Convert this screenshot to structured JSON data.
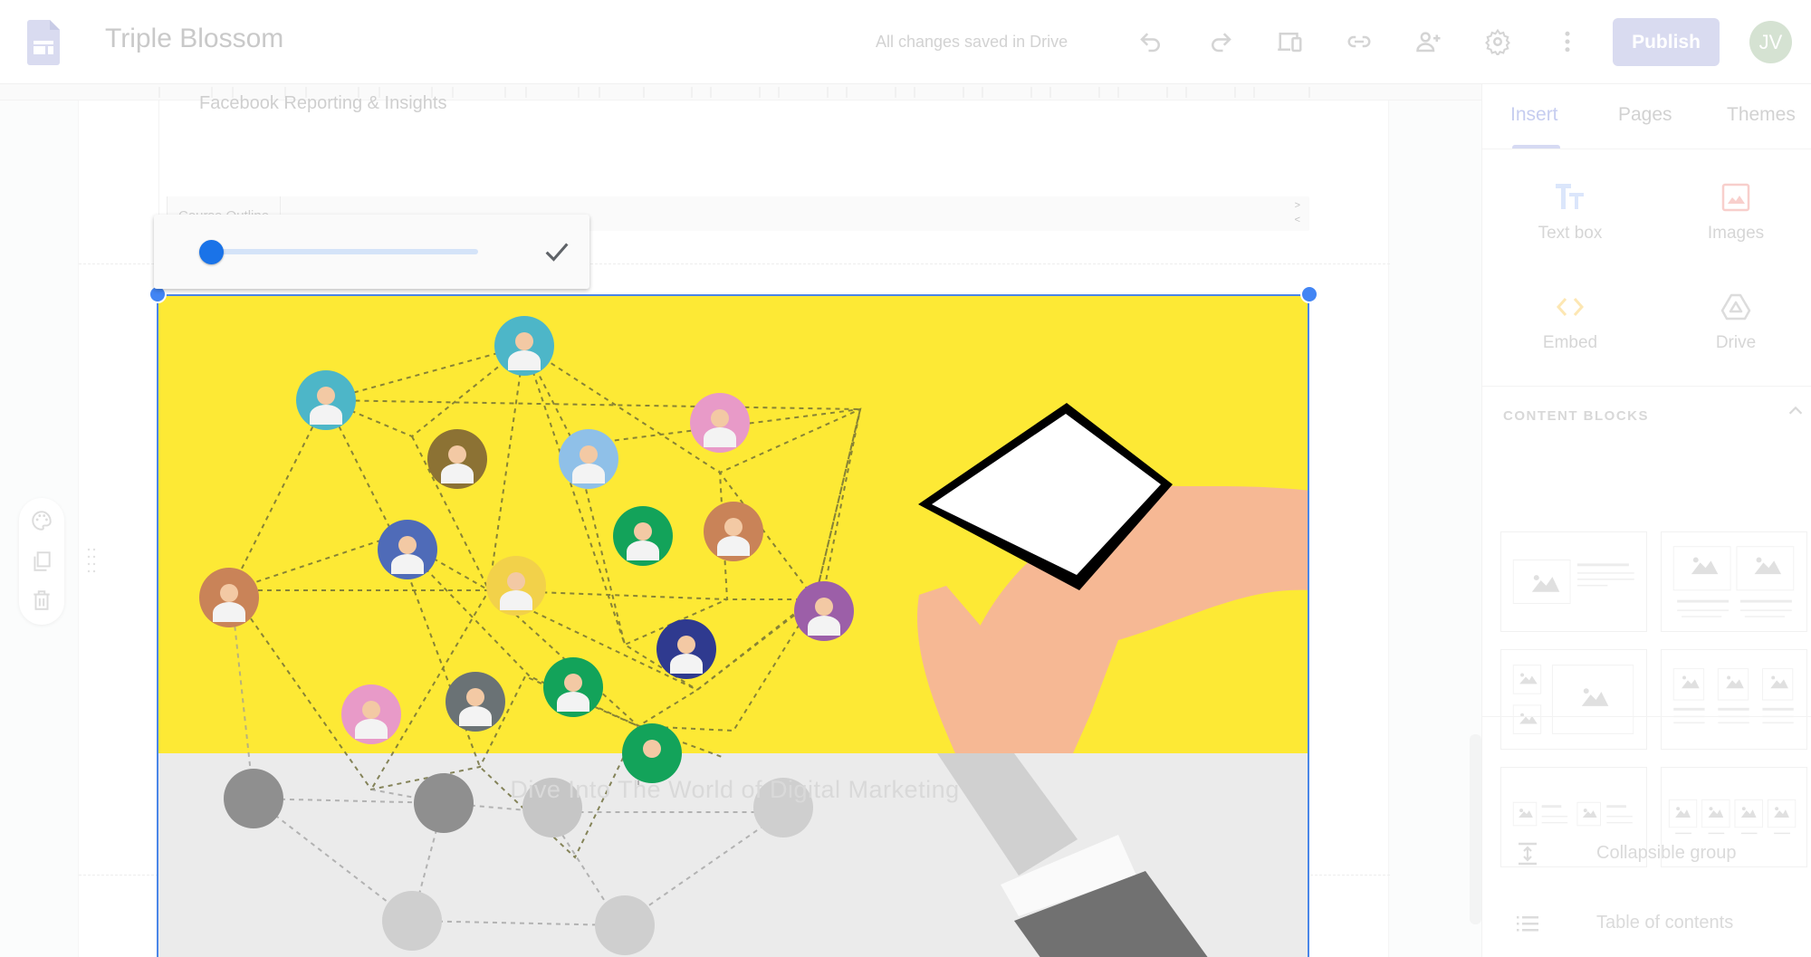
{
  "app": {
    "document_title": "Triple Blossom",
    "save_status": "All changes saved in Drive",
    "publish_label": "Publish",
    "user_initials": "JV",
    "colors": {
      "accent": "#1a73e8",
      "selection": "#4a86e8",
      "publish_bg": "#d9dbf0",
      "avatar_bg": "#d5e2d2",
      "banner_yellow": "#fde935"
    }
  },
  "toolbar": {
    "icons": [
      "undo-icon",
      "redo-icon",
      "preview-icon",
      "link-icon",
      "add-person-icon",
      "settings-icon",
      "more-vert-icon"
    ]
  },
  "canvas": {
    "section_text": "Facebook Reporting & Insights",
    "nav_tab": "Course Outline",
    "nav_arrows": {
      "next": ">",
      "prev": "<"
    },
    "banner_overlay_text": "Dive Into The World of Digital Marketing",
    "image_slider": {
      "value_fraction": 0.0
    },
    "floating_tools": [
      "palette-icon",
      "duplicate-icon",
      "delete-icon"
    ]
  },
  "sidebar": {
    "tabs": [
      {
        "label": "Insert",
        "active": true
      },
      {
        "label": "Pages",
        "active": false
      },
      {
        "label": "Themes",
        "active": false
      }
    ],
    "insert_items": [
      {
        "label": "Text box",
        "icon": "text-box-icon"
      },
      {
        "label": "Images",
        "icon": "image-icon"
      },
      {
        "label": "Embed",
        "icon": "embed-icon"
      },
      {
        "label": "Drive",
        "icon": "drive-icon"
      }
    ],
    "content_blocks_title": "CONTENT BLOCKS",
    "content_blocks": [
      "image-with-text-layout",
      "two-images-with-captions-layout",
      "three-images-mosaic-layout",
      "three-images-with-captions-layout",
      "two-small-images-with-text-layout",
      "four-images-row-layout"
    ],
    "extra_items": [
      {
        "label": "Collapsible group",
        "icon": "collapsible-group-icon"
      },
      {
        "label": "Table of contents",
        "icon": "table-of-contents-icon"
      }
    ]
  }
}
